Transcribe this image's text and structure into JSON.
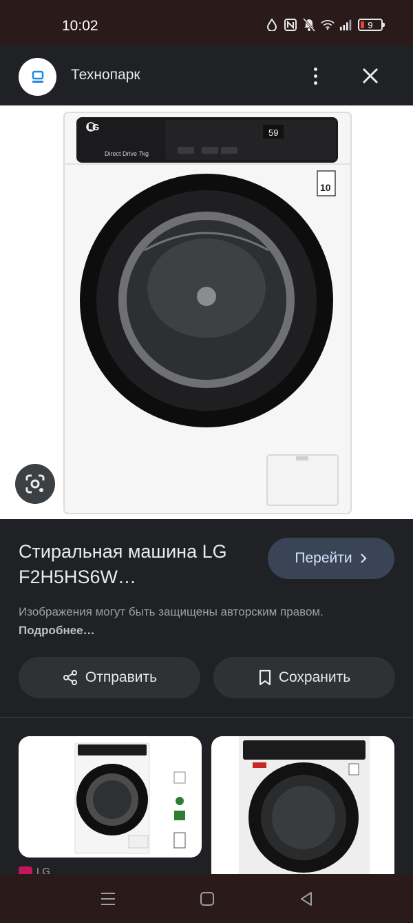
{
  "status_bar": {
    "time": "10:02",
    "battery_level": "9",
    "icons": [
      "data-saver-icon",
      "nfc-icon",
      "bell-off-icon",
      "wifi-icon",
      "signal-icon",
      "battery-icon"
    ]
  },
  "header": {
    "site_name": "Технопарк",
    "logo_icon": "technopark-logo-icon",
    "more_icon": "more-vert-icon",
    "close_icon": "close-icon"
  },
  "main_image": {
    "brand": "LG",
    "model_badge": "Direct Drive 7kg",
    "display_value": "59",
    "warranty_badge": "10"
  },
  "info": {
    "title": "Стиральная машина LG F2H5HS6W…",
    "go_label": "Перейти",
    "disclaimer_text": "Изображения могут быть защищены авторским правом.",
    "disclaimer_link": "Подробнее…",
    "share_label": "Отправить",
    "save_label": "Сохранить"
  },
  "related": {
    "source_name": "LG"
  },
  "colors": {
    "background": "#202124",
    "primary_button": "#394457",
    "secondary_button": "#303134",
    "system_bar": "#2a1a1a"
  }
}
